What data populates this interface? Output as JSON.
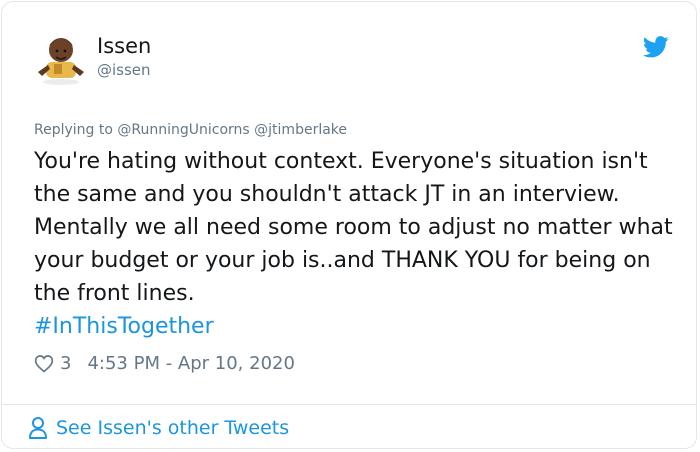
{
  "user": {
    "display_name": "Issen",
    "handle": "@issen"
  },
  "tweet": {
    "reply_prefix": "Replying to",
    "reply_mentions": "@RunningUnicorns @jtimberlake",
    "text": "You're hating without context. Everyone's situation isn't the same and you shouldn't attack JT in an interview. Mentally we all need some room to adjust no matter what your budget or your job is..and THANK YOU for being on the front lines.",
    "hashtag": "#InThisTogether",
    "like_count": "3",
    "timestamp": "4:53 PM - Apr 10, 2020"
  },
  "footer": {
    "label": "See Issen's other Tweets"
  },
  "colors": {
    "accent": "#1b95e0",
    "muted": "#657786",
    "text": "#14171a",
    "border": "#e1e8ed"
  },
  "icons": [
    "avatar-bitmoji",
    "twitter-bird-icon",
    "heart-icon",
    "person-icon"
  ]
}
